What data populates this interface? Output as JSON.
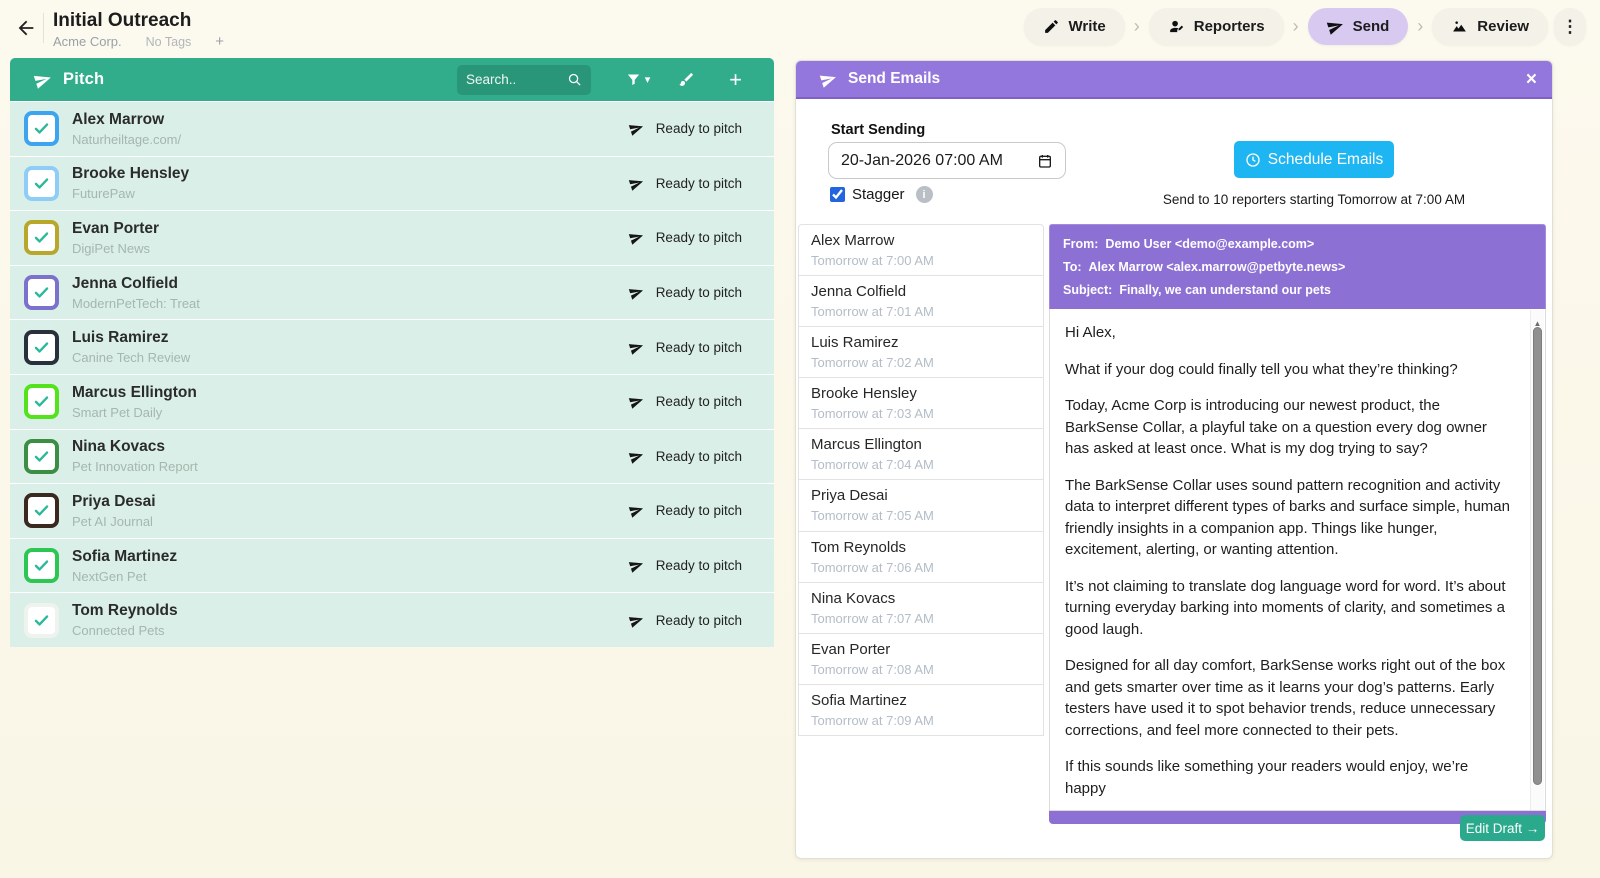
{
  "glyphs": {
    "chevron": "›",
    "dots": "⋮",
    "plus": "+",
    "close": "×",
    "caret_down": "▾",
    "info": "i",
    "scroll_up": "▲"
  },
  "colors": {
    "pitch_teal": "#31ad8c",
    "row_mint": "#d9efe7",
    "send_purple": "#9477dd",
    "meta_purple": "#8c70d3",
    "schedule_cyan": "#1db5f2",
    "edit_draft_teal": "#2aa98c",
    "active_step_purple": "#d8c9f1"
  },
  "header": {
    "title": "Initial Outreach",
    "company": "Acme Corp.",
    "tags_label": "No Tags",
    "add_tag": "+",
    "nav": [
      {
        "label": "Write"
      },
      {
        "label": "Reporters"
      },
      {
        "label": "Send",
        "active": true
      },
      {
        "label": "Review"
      }
    ]
  },
  "pitch_panel": {
    "title": "Pitch",
    "search_placeholder": "Search..",
    "reporters": [
      {
        "name": "Alex Marrow",
        "outlet": "Naturheiltage.com/",
        "color": "#3da5f0",
        "status": "Ready to pitch"
      },
      {
        "name": "Brooke Hensley",
        "outlet": "FuturePaw",
        "color": "#8fcdf6",
        "status": "Ready to pitch"
      },
      {
        "name": "Evan Porter",
        "outlet": "DigiPet News",
        "color": "#b9a72c",
        "status": "Ready to pitch"
      },
      {
        "name": "Jenna Colfield",
        "outlet": "ModernPetTech: Treat",
        "color": "#7b72cc",
        "status": "Ready to pitch"
      },
      {
        "name": "Luis Ramirez",
        "outlet": "Canine Tech Review",
        "color": "#28313b",
        "status": "Ready to pitch"
      },
      {
        "name": "Marcus Ellington",
        "outlet": "Smart Pet Daily",
        "color": "#53e31d",
        "status": "Ready to pitch"
      },
      {
        "name": "Nina Kovacs",
        "outlet": "Pet Innovation Report",
        "color": "#3c8e44",
        "status": "Ready to pitch"
      },
      {
        "name": "Priya Desai",
        "outlet": "Pet AI Journal",
        "color": "#3a291e",
        "status": "Ready to pitch"
      },
      {
        "name": "Sofia Martinez",
        "outlet": "NextGen Pet",
        "color": "#2dc653",
        "status": "Ready to pitch"
      },
      {
        "name": "Tom Reynolds",
        "outlet": "Connected Pets",
        "color": "#eef3ed",
        "status": "Ready to pitch"
      }
    ]
  },
  "send_panel": {
    "title": "Send Emails",
    "start_sending_label": "Start Sending",
    "datetime_value": "20-Jan-2026 07:00 AM",
    "stagger_label": "Stagger",
    "schedule_button": "Schedule Emails",
    "summary": "Send to 10 reporters starting Tomorrow at 7:00 AM",
    "schedule": [
      {
        "name": "Alex Marrow",
        "time": "Tomorrow at 7:00 AM"
      },
      {
        "name": "Jenna Colfield",
        "time": "Tomorrow at 7:01 AM"
      },
      {
        "name": "Luis Ramirez",
        "time": "Tomorrow at 7:02 AM"
      },
      {
        "name": "Brooke Hensley",
        "time": "Tomorrow at 7:03 AM"
      },
      {
        "name": "Marcus Ellington",
        "time": "Tomorrow at 7:04 AM"
      },
      {
        "name": "Priya Desai",
        "time": "Tomorrow at 7:05 AM"
      },
      {
        "name": "Tom Reynolds",
        "time": "Tomorrow at 7:06 AM"
      },
      {
        "name": "Nina Kovacs",
        "time": "Tomorrow at 7:07 AM"
      },
      {
        "name": "Evan Porter",
        "time": "Tomorrow at 7:08 AM"
      },
      {
        "name": "Sofia Martinez",
        "time": "Tomorrow at 7:09 AM"
      }
    ],
    "email_preview": {
      "from_label": "From:",
      "from_value": "Demo User <demo@example.com>",
      "to_label": "To:",
      "to_value": "Alex Marrow <alex.marrow@petbyte.news>",
      "subject_label": "Subject:",
      "subject_value": "Finally, we can understand our pets",
      "body_paragraphs": [
        "Hi Alex,",
        "What if your dog could finally tell you what they’re thinking?",
        "Today, Acme Corp is introducing our newest product, the BarkSense Collar, a playful take on a question every dog owner has asked at least once. What is my dog trying to say?",
        "The BarkSense Collar uses sound pattern recognition and activity data to interpret different types of barks and surface simple, human friendly insights in a companion app. Things like hunger, excitement, alerting, or wanting attention.",
        "It’s not claiming to translate dog language word for word. It’s about turning everyday barking into moments of clarity, and sometimes a good laugh.",
        "Designed for all day comfort, BarkSense works right out of the box and gets smarter over time as it learns your dog’s patterns. Early testers have used it to spot behavior trends, reduce unnecessary corrections, and feel more connected to their pets.",
        "If this sounds like something your readers would enjoy, we’re happy"
      ]
    },
    "edit_draft_button": "Edit Draft →"
  }
}
